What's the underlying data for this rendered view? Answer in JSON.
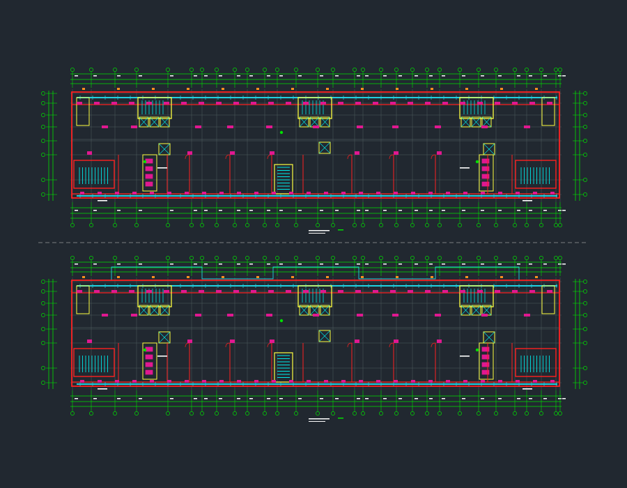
{
  "drawing": {
    "background": "#212830",
    "colors": {
      "grid": "#00e000",
      "wall": "#ff2020",
      "window": "#20d0e0",
      "core": "#ffff40",
      "stair": "#00e8e8",
      "column": "#e01890",
      "dim": "#ffffff",
      "dash": "#9a9a9a"
    },
    "plans": [
      {
        "id": "plan-upper",
        "title": "",
        "has_bay_outline": false
      },
      {
        "id": "plan-lower",
        "title": "",
        "has_bay_outline": true
      }
    ]
  }
}
